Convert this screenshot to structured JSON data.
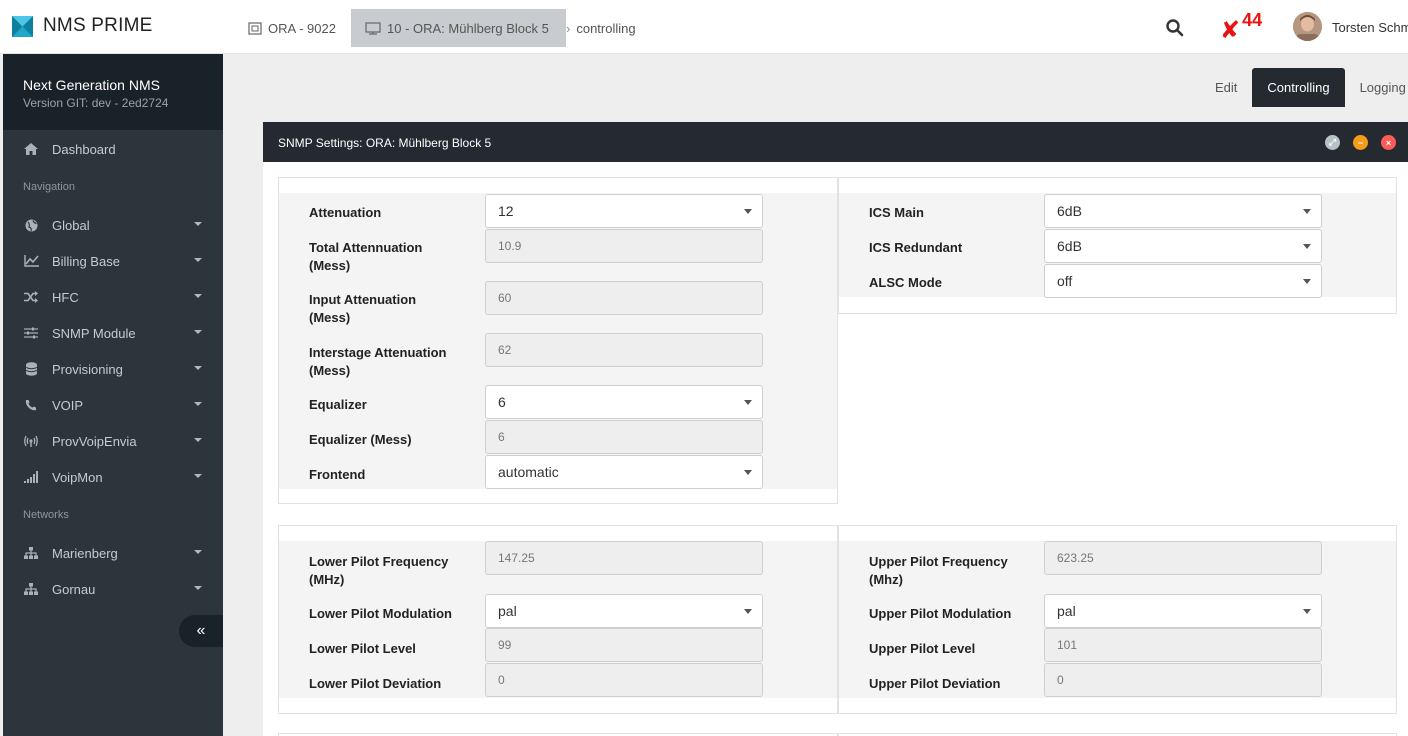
{
  "app": {
    "name": "NMS PRIME"
  },
  "breadcrumbs": [
    {
      "label": "ORA - 9022"
    },
    {
      "label": "10 - ORA: Mühlberg Block 5"
    },
    {
      "label": "controlling"
    }
  ],
  "header": {
    "alert_count": "44",
    "user_name": "Torsten Schm"
  },
  "sidebar": {
    "title": "Next Generation NMS",
    "version": "Version GIT: dev - 2ed2724",
    "dashboard": "Dashboard",
    "navigation_heading": "Navigation",
    "items": [
      {
        "label": "Global",
        "icon": "globe-icon"
      },
      {
        "label": "Billing Base",
        "icon": "chart-line-icon"
      },
      {
        "label": "HFC",
        "icon": "shuffle-icon"
      },
      {
        "label": "SNMP Module",
        "icon": "sliders-icon"
      },
      {
        "label": "Provisioning",
        "icon": "database-icon"
      },
      {
        "label": "VOIP",
        "icon": "phone-icon"
      },
      {
        "label": "ProvVoipEnvia",
        "icon": "broadcast-icon"
      },
      {
        "label": "VoipMon",
        "icon": "signal-icon"
      }
    ],
    "networks_heading": "Networks",
    "networks": [
      {
        "label": "Marienberg",
        "icon": "sitemap-icon"
      },
      {
        "label": "Gornau",
        "icon": "sitemap-icon"
      }
    ],
    "collapse_symbol": "«"
  },
  "tabs": [
    {
      "label": "Edit",
      "active": false
    },
    {
      "label": "Controlling",
      "active": true
    },
    {
      "label": "Logging",
      "active": false
    }
  ],
  "panel": {
    "title": "SNMP Settings: ORA: Mühlberg Block 5",
    "attenuation": {
      "label": "Attenuation",
      "value": "12"
    },
    "total_attenuation": {
      "label_1": "Total Attennuation",
      "label_2": "(Mess)",
      "value": "10.9"
    },
    "input_attenuation": {
      "label_1": "Input Attenuation",
      "label_2": "(Mess)",
      "value": "60"
    },
    "interstage_attenuation": {
      "label_1": "Interstage Attenuation",
      "label_2": "(Mess)",
      "value": "62"
    },
    "equalizer": {
      "label": "Equalizer",
      "value": "6"
    },
    "equalizer_mess": {
      "label": "Equalizer (Mess)",
      "value": "6"
    },
    "frontend": {
      "label": "Frontend",
      "value": "automatic"
    },
    "ics_main": {
      "label": "ICS Main",
      "value": "6dB"
    },
    "ics_redundant": {
      "label": "ICS Redundant",
      "value": "6dB"
    },
    "alsc_mode": {
      "label": "ALSC Mode",
      "value": "off"
    },
    "lower_pilot_frequency": {
      "label_1": "Lower Pilot Frequency",
      "label_2": "(MHz)",
      "value": "147.25"
    },
    "lower_pilot_modulation": {
      "label": "Lower Pilot Modulation",
      "value": "pal"
    },
    "lower_pilot_level": {
      "label": "Lower Pilot Level",
      "value": "99"
    },
    "lower_pilot_deviation": {
      "label": "Lower Pilot Deviation",
      "value": "0"
    },
    "upper_pilot_frequency": {
      "label_1": "Upper Pilot Frequency",
      "label_2": "(Mhz)",
      "value": "623.25"
    },
    "upper_pilot_modulation": {
      "label": "Upper Pilot Modulation",
      "value": "pal"
    },
    "upper_pilot_level": {
      "label": "Upper Pilot Level",
      "value": "101"
    },
    "upper_pilot_deviation": {
      "label": "Upper Pilot Deviation",
      "value": "0"
    }
  },
  "colors": {
    "sidebar_bg": "#2d353c",
    "sidebar_head_bg": "#1a2229",
    "panel_head_bg": "#242a30",
    "alert": "#ee1111",
    "brand_accent": "#17a2b8"
  }
}
